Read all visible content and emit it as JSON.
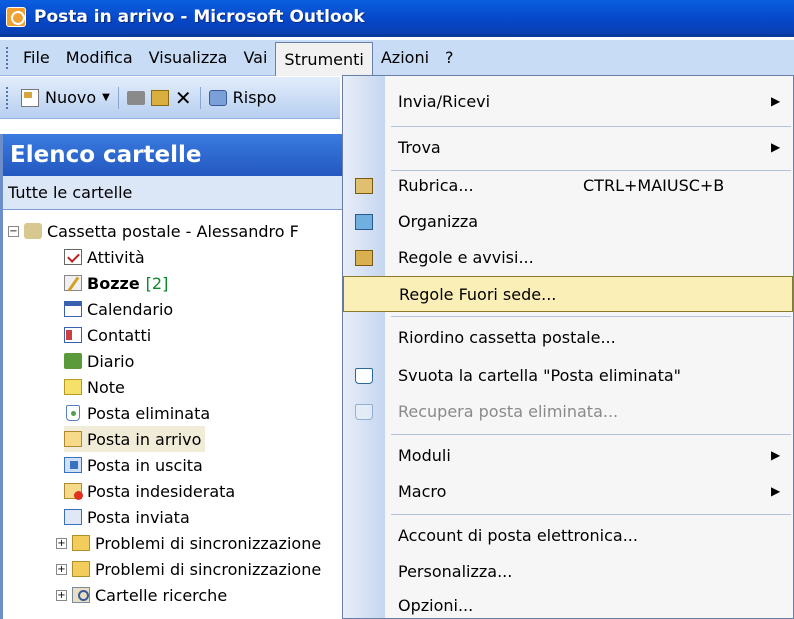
{
  "window": {
    "title": "Posta in arrivo - Microsoft Outlook"
  },
  "menubar": {
    "items": [
      "File",
      "Modifica",
      "Visualizza",
      "Vai",
      "Strumenti",
      "Azioni",
      "?"
    ],
    "active": "Strumenti"
  },
  "toolbar": {
    "new_label": "Nuovo",
    "reply_label": "Rispo"
  },
  "folder_pane": {
    "header": "Elenco cartelle",
    "subheader": "Tutte le cartelle",
    "mailbox": "Cassetta postale - Alessandro F",
    "folders": [
      {
        "label": "Attività",
        "icon": "tasks-icon"
      },
      {
        "label": "Bozze",
        "icon": "drafts-icon",
        "count": "[2]",
        "bold": true
      },
      {
        "label": "Calendario",
        "icon": "calendar-icon"
      },
      {
        "label": "Contatti",
        "icon": "contacts-icon"
      },
      {
        "label": "Diario",
        "icon": "journal-icon"
      },
      {
        "label": "Note",
        "icon": "notes-icon"
      },
      {
        "label": "Posta eliminata",
        "icon": "deleted-items-icon"
      },
      {
        "label": "Posta in arrivo",
        "icon": "inbox-icon",
        "selected": true
      },
      {
        "label": "Posta in uscita",
        "icon": "outbox-icon"
      },
      {
        "label": "Posta indesiderata",
        "icon": "junk-mail-icon"
      },
      {
        "label": "Posta inviata",
        "icon": "sent-items-icon"
      }
    ],
    "collapsed_folders": [
      {
        "label": "Problemi di sincronizzazione",
        "icon": "folder-icon"
      },
      {
        "label": "Problemi di sincronizzazione",
        "icon": "folder-icon"
      },
      {
        "label": "Cartelle ricerche",
        "icon": "search-folder-icon"
      }
    ]
  },
  "tools_menu": {
    "items": [
      {
        "label": "Invia/Ricevi",
        "submenu": true
      },
      {
        "label": "Trova",
        "submenu": true
      },
      {
        "label": "Rubrica...",
        "shortcut": "CTRL+MAIUSC+B",
        "icon": "address-book-icon"
      },
      {
        "label": "Organizza",
        "icon": "organize-icon"
      },
      {
        "label": "Regole e avvisi...",
        "icon": "rules-icon"
      },
      {
        "label": "Regole Fuori sede...",
        "highlighted": true
      },
      {
        "label": "Riordino cassetta postale..."
      },
      {
        "label": "Svuota la cartella \"Posta eliminata\"",
        "icon": "empty-trash-icon"
      },
      {
        "label": "Recupera posta eliminata...",
        "icon": "recover-icon",
        "disabled": true
      },
      {
        "label": "Moduli",
        "submenu": true
      },
      {
        "label": "Macro",
        "submenu": true
      },
      {
        "label": "Account di posta elettronica..."
      },
      {
        "label": "Personalizza..."
      },
      {
        "label": "Opzioni..."
      }
    ]
  },
  "colors": {
    "title_bar": "#0547c8",
    "menubar_bg": "#c8dcf5",
    "highlight": "#fbefb8",
    "count": "#0a8a2a"
  }
}
